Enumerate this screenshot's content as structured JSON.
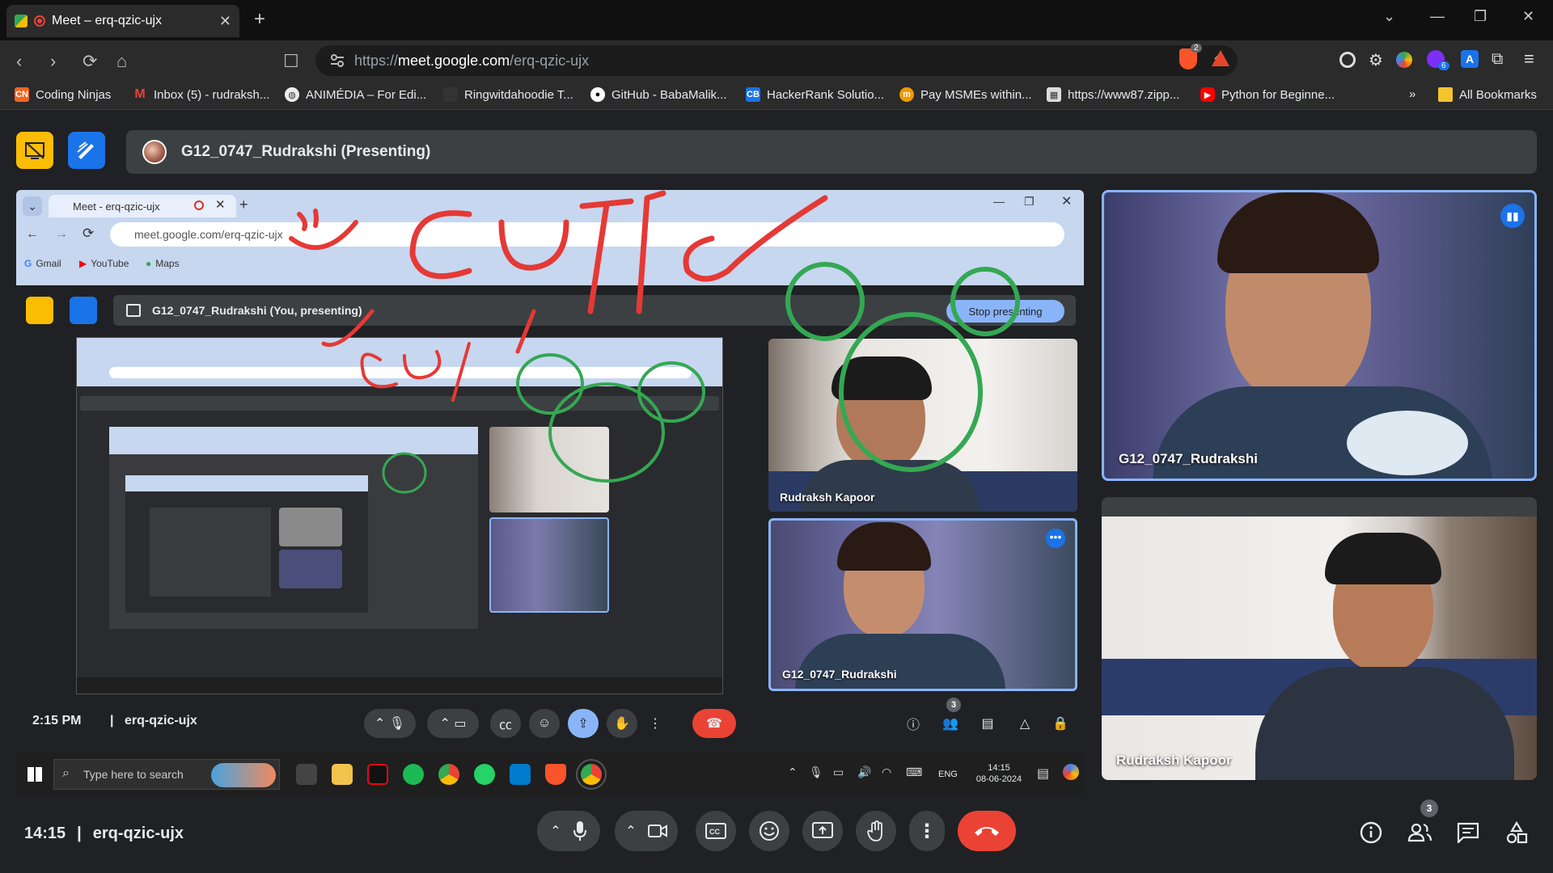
{
  "browser": {
    "tab_title": "Meet – erq-qzic-ujx",
    "url_prefix": "https://",
    "url_domain": "meet.google.com",
    "url_path": "/erq-qzic-ujx",
    "bookmarks": [
      {
        "label": "Coding Ninjas",
        "icon": "coding-ninjas-icon",
        "color": "#f26522"
      },
      {
        "label": "Inbox (5) - rudraksh...",
        "icon": "gmail-icon",
        "color": "#ea4335"
      },
      {
        "label": "ANIMÉDIA – For Edi...",
        "icon": "globe-icon",
        "color": "#ffffff"
      },
      {
        "label": "Ringwitdahoodie T...",
        "icon": "bookmark-icon",
        "color": "#333333"
      },
      {
        "label": "GitHub - BabaMalik...",
        "icon": "github-icon",
        "color": "#ffffff"
      },
      {
        "label": "HackerRank Solutio...",
        "icon": "codebeautify-icon",
        "color": "#1a73e8"
      },
      {
        "label": "Pay MSMEs within...",
        "icon": "m-icon",
        "color": "#f29900"
      },
      {
        "label": "https://www87.zipp...",
        "icon": "zipp-icon",
        "color": "#dddddd"
      },
      {
        "label": "Python for Beginne...",
        "icon": "youtube-icon",
        "color": "#ff0000"
      }
    ],
    "more_bookmarks": "»",
    "all_bookmarks": "All Bookmarks",
    "ext_badge_brave": "2",
    "ext_badge_six": "6"
  },
  "meet": {
    "presenter_name": "G12_0747_Rudrakshi (Presenting)",
    "time": "14:15",
    "separator": "|",
    "meeting_code": "erq-qzic-ujx",
    "people_count": "3",
    "accent": "#8ab4f8",
    "end_call_color": "#ea4335",
    "participants": [
      {
        "name": "G12_0747_Rudrakshi"
      },
      {
        "name": "Rudraksh Kapoor"
      }
    ]
  },
  "shared_screen": {
    "tab_title": "Meet - erq-qzic-ujx",
    "url": "meet.google.com/erq-qzic-ujx",
    "bookmarks": [
      "Gmail",
      "YouTube",
      "Maps"
    ],
    "presenter_bar": "G12_0747_Rudrakshi (You, presenting)",
    "stop_presenting": "Stop presenting",
    "tile1_name": "Rudraksh Kapoor",
    "tile2_name": "G12_0747_Rudrakshi",
    "time": "2:15 PM",
    "separator": "|",
    "meeting_code": "erq-qzic-ujx",
    "people_count": "3",
    "search_placeholder": "Type here to search",
    "tray_clock": "14:15",
    "tray_date": "08-06-2024",
    "tray_lang": "ENG",
    "annotation_text": "CUTIE",
    "annotation_color": "#e53935",
    "ears_color": "#34a853"
  }
}
